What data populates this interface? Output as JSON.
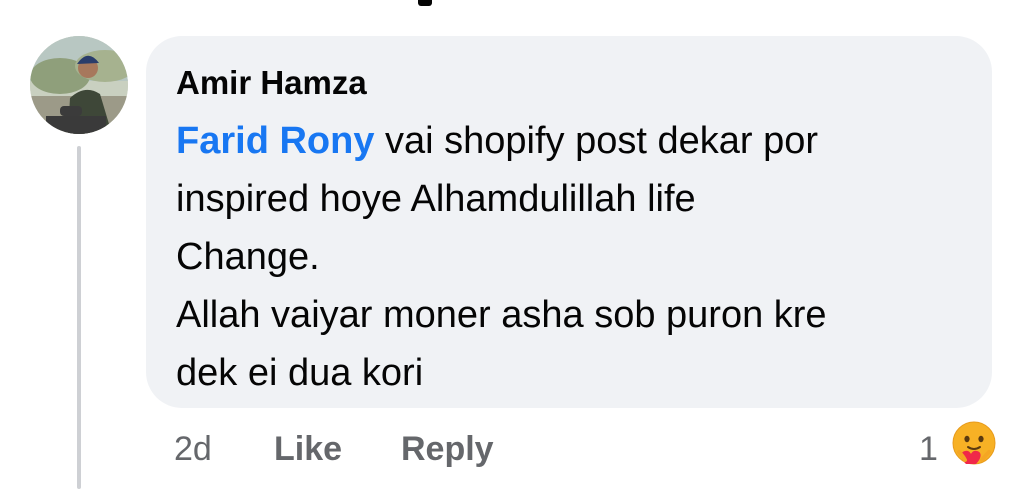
{
  "comment": {
    "author": "Amir Hamza",
    "mention": "Farid Rony",
    "text_line1": " vai shopify post dekar por",
    "text_line2": "inspired hoye Alhamdulillah life",
    "text_line3": "Change.",
    "text_line4": "Allah vaiyar moner asha sob puron kre",
    "text_line5": "dek ei dua kori"
  },
  "actions": {
    "time": "2d",
    "like_label": "Like",
    "reply_label": "Reply"
  },
  "reactions": {
    "count": "1",
    "icon": "care-reaction-icon"
  },
  "colors": {
    "bubble": "#f0f2f5",
    "mention": "#1877f2",
    "meta": "#65676b"
  }
}
